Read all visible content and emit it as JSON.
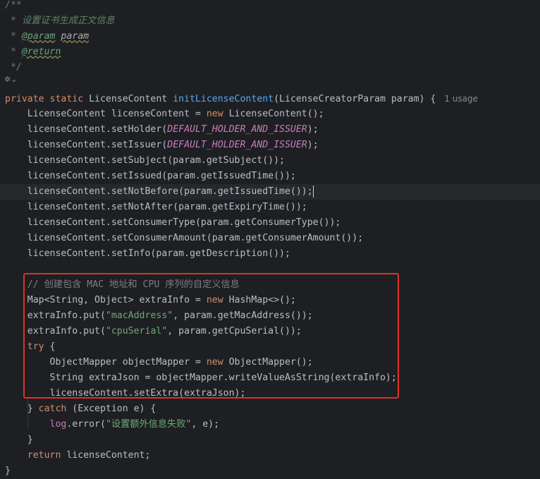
{
  "editor": {
    "usage_hint": "1 usage",
    "lines": [
      {
        "segments": [
          {
            "t": "/**",
            "c": "doc"
          }
        ]
      },
      {
        "segments": [
          {
            "t": " * ",
            "c": "doc"
          },
          {
            "t": "设置证书生成正文信息",
            "c": "doc"
          }
        ]
      },
      {
        "segments": [
          {
            "t": " * ",
            "c": "doc"
          },
          {
            "t": "@param",
            "c": "doctag"
          },
          {
            "t": " ",
            "c": "doc"
          },
          {
            "t": "param",
            "c": "docparam"
          }
        ]
      },
      {
        "segments": [
          {
            "t": " * ",
            "c": "doc"
          },
          {
            "t": "@return",
            "c": "doctag"
          }
        ]
      },
      {
        "segments": [
          {
            "t": " */",
            "c": "doc"
          }
        ]
      },
      {
        "segments": []
      },
      {
        "segments": [
          {
            "t": "private static ",
            "c": "kw"
          },
          {
            "t": "LicenseContent ",
            "c": ""
          },
          {
            "t": "initLicenseContent",
            "c": "fn"
          },
          {
            "t": "(LicenseCreatorParam param) {",
            "c": ""
          }
        ],
        "usage": true
      },
      {
        "segments": [
          {
            "t": "    LicenseContent licenseContent = ",
            "c": ""
          },
          {
            "t": "new ",
            "c": "kw"
          },
          {
            "t": "LicenseContent();",
            "c": ""
          }
        ]
      },
      {
        "segments": [
          {
            "t": "    licenseContent.setHolder(",
            "c": ""
          },
          {
            "t": "DEFAULT_HOLDER_AND_ISSUER",
            "c": "const"
          },
          {
            "t": ");",
            "c": ""
          }
        ]
      },
      {
        "segments": [
          {
            "t": "    licenseContent.setIssuer(",
            "c": ""
          },
          {
            "t": "DEFAULT_HOLDER_AND_ISSUER",
            "c": "const"
          },
          {
            "t": ");",
            "c": ""
          }
        ]
      },
      {
        "segments": [
          {
            "t": "    licenseContent.setSubject(param.getSubject());",
            "c": ""
          }
        ]
      },
      {
        "segments": [
          {
            "t": "    licenseContent.setIssued(param.getIssuedTime());",
            "c": ""
          }
        ]
      },
      {
        "segments": [
          {
            "t": "    licenseContent.setNotBefore(param.getIssuedTime());",
            "c": ""
          }
        ],
        "caret": true,
        "highlight": true
      },
      {
        "segments": [
          {
            "t": "    licenseContent.setNotAfter(param.getExpiryTime());",
            "c": ""
          }
        ]
      },
      {
        "segments": [
          {
            "t": "    licenseContent.setConsumerType(param.getConsumerType());",
            "c": ""
          }
        ]
      },
      {
        "segments": [
          {
            "t": "    licenseContent.setConsumerAmount(param.getConsumerAmount());",
            "c": ""
          }
        ]
      },
      {
        "segments": [
          {
            "t": "    licenseContent.setInfo(param.getDescription());",
            "c": ""
          }
        ]
      },
      {
        "segments": []
      },
      {
        "segments": [
          {
            "t": "    // 创建包含 MAC 地址和 CPU 序列的自定义信息",
            "c": "cmt"
          }
        ]
      },
      {
        "segments": [
          {
            "t": "    Map<String, Object> extraInfo = ",
            "c": ""
          },
          {
            "t": "new ",
            "c": "kw"
          },
          {
            "t": "HashMap<>();",
            "c": ""
          }
        ]
      },
      {
        "segments": [
          {
            "t": "    extraInfo.put(",
            "c": ""
          },
          {
            "t": "\"macAddress\"",
            "c": "str"
          },
          {
            "t": ", param.getMacAddress());",
            "c": ""
          }
        ]
      },
      {
        "segments": [
          {
            "t": "    extraInfo.put(",
            "c": ""
          },
          {
            "t": "\"cpuSerial\"",
            "c": "str"
          },
          {
            "t": ", param.getCpuSerial());",
            "c": ""
          }
        ]
      },
      {
        "segments": [
          {
            "t": "    ",
            "c": ""
          },
          {
            "t": "try ",
            "c": "kw"
          },
          {
            "t": "{",
            "c": ""
          }
        ]
      },
      {
        "segments": [
          {
            "t": "        ObjectMapper objectMapper = ",
            "c": ""
          },
          {
            "t": "new ",
            "c": "kw"
          },
          {
            "t": "ObjectMapper();",
            "c": ""
          }
        ]
      },
      {
        "segments": [
          {
            "t": "        String extraJson = objectMapper.writeValueAsString(extraInfo);",
            "c": ""
          }
        ]
      },
      {
        "segments": [
          {
            "t": "        licenseContent.setExtra(extraJson);",
            "c": ""
          }
        ]
      },
      {
        "segments": [
          {
            "t": "    } ",
            "c": ""
          },
          {
            "t": "catch ",
            "c": "kw"
          },
          {
            "t": "(Exception e) {",
            "c": ""
          }
        ]
      },
      {
        "segments": [
          {
            "t": "        ",
            "c": ""
          },
          {
            "t": "log",
            "c": "field"
          },
          {
            "t": ".error(",
            "c": ""
          },
          {
            "t": "\"设置额外信息失败\"",
            "c": "str"
          },
          {
            "t": ", e);",
            "c": ""
          }
        ]
      },
      {
        "segments": [
          {
            "t": "    }",
            "c": ""
          }
        ]
      },
      {
        "segments": [
          {
            "t": "    ",
            "c": ""
          },
          {
            "t": "return ",
            "c": "kw"
          },
          {
            "t": "licenseContent;",
            "c": ""
          }
        ]
      },
      {
        "segments": [
          {
            "t": "}",
            "c": ""
          }
        ]
      }
    ]
  },
  "gutter": {
    "icon": "ai-sparkle-icon"
  },
  "colors": {
    "background": "#1e1f22",
    "keyword": "#cf8e6d",
    "method": "#56a8f5",
    "string": "#6aab73",
    "constant": "#c77dbb",
    "comment": "#7a7e85",
    "highlight_box": "#e0302b"
  }
}
